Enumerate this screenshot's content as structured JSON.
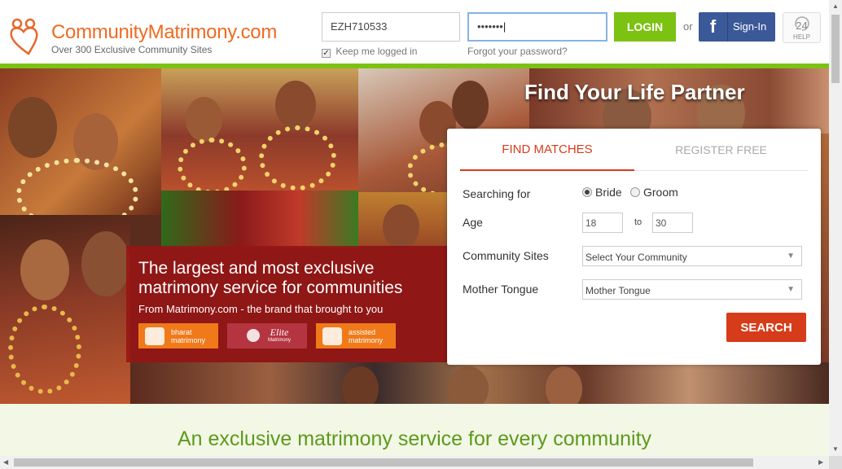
{
  "header": {
    "brand_name": "CommunityMatrimony.com",
    "tagline": "Over 300 Exclusive Community Sites",
    "username_value": "EZH710533",
    "password_value": "•••••••",
    "login_label": "LOGIN",
    "or_text": "or",
    "fb_icon": "f",
    "fb_label": "Sign-In",
    "help_number": "24",
    "help_label": "HELP",
    "keep_logged_in": "Keep me logged in",
    "forgot_password": "Forgot your password?"
  },
  "hero": {
    "headline": "Find Your Life Partner",
    "promo_title": "The largest and most exclusive matrimony service for communities",
    "promo_subtitle": "From Matrimony.com - the brand that brought to you",
    "brands": [
      {
        "line1": "bharat",
        "line2": "matrimony"
      },
      {
        "line1": "Elite",
        "line2": "Matrimony"
      },
      {
        "line1": "assisted",
        "line2": "matrimony"
      }
    ]
  },
  "search": {
    "tab_find": "FIND MATCHES",
    "tab_register": "REGISTER FREE",
    "searching_for_label": "Searching for",
    "option_bride": "Bride",
    "option_groom": "Groom",
    "selected": "Bride",
    "age_label": "Age",
    "age_from": "18",
    "age_to_word": "to",
    "age_to": "30",
    "community_label": "Community Sites",
    "community_value": "Select Your Community",
    "tongue_label": "Mother Tongue",
    "tongue_value": "Mother Tongue",
    "search_label": "SEARCH"
  },
  "band": {
    "title": "An exclusive matrimony service for every community"
  },
  "colors": {
    "brand_orange": "#f06a21",
    "login_green": "#7cc213",
    "search_red": "#d63c1a",
    "facebook_blue": "#3b5998",
    "band_green_text": "#5c9a1b"
  }
}
